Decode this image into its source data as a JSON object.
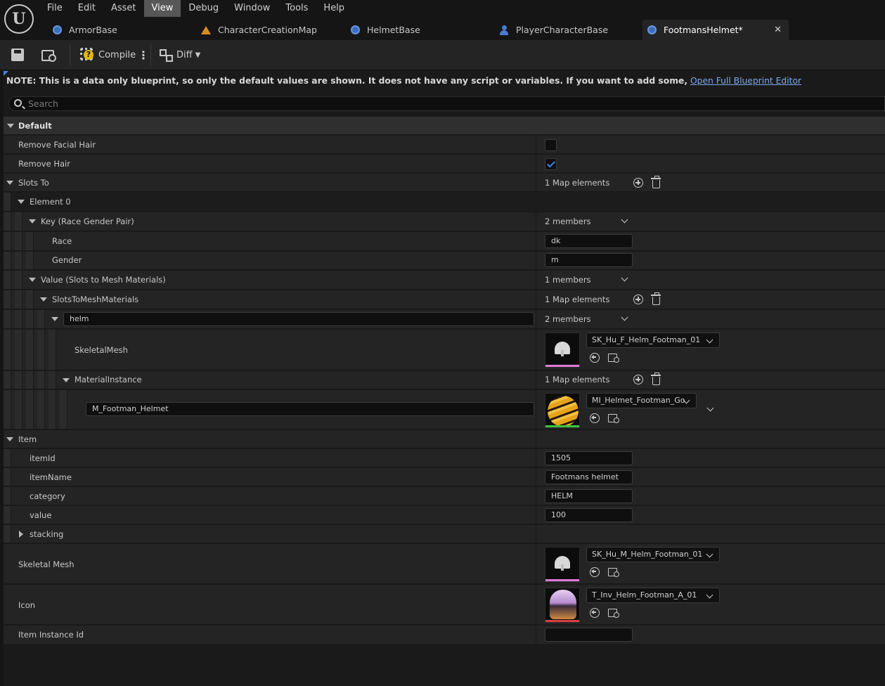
{
  "menu": [
    "File",
    "Edit",
    "Asset",
    "View",
    "Debug",
    "Window",
    "Tools",
    "Help"
  ],
  "menu_active": "View",
  "tabs": [
    {
      "label": "ArmorBase",
      "icon": "blueprint-icon"
    },
    {
      "label": "CharacterCreationMap",
      "icon": "level-map-icon"
    },
    {
      "label": "HelmetBase",
      "icon": "blueprint-icon"
    },
    {
      "label": "PlayerCharacterBase",
      "icon": "character-icon"
    },
    {
      "label": "FootmansHelmet*",
      "icon": "blueprint-icon",
      "active": true
    }
  ],
  "toolbar": {
    "compile_label": "Compile",
    "diff_label": "Diff"
  },
  "note": {
    "text": "NOTE: This is a data only blueprint, so only the default values are shown.  It does not have any script or variables.  If you want to add some,",
    "link": "Open Full Blueprint Editor"
  },
  "search": {
    "placeholder": "Search"
  },
  "details": {
    "default_category": "Default",
    "remove_facial_hair": {
      "label": "Remove Facial Hair",
      "checked": false
    },
    "remove_hair": {
      "label": "Remove Hair",
      "checked": true
    },
    "slots_to": {
      "label": "Slots To",
      "value": "1 Map elements"
    },
    "element0": {
      "label": "Element 0"
    },
    "key": {
      "label": "Key (Race Gender Pair)",
      "value": "2 members"
    },
    "race": {
      "label": "Race",
      "value": "dk"
    },
    "gender": {
      "label": "Gender",
      "value": "m"
    },
    "value_struct": {
      "label": "Value (Slots to Mesh Materials)",
      "value": "1 members"
    },
    "slots_to_mesh": {
      "label": "SlotsToMeshMaterials",
      "value": "1 Map elements"
    },
    "helm": {
      "key": "helm",
      "value": "2 members"
    },
    "skeletal_mesh_inner": {
      "label": "SkeletalMesh",
      "asset": "SK_Hu_F_Helm_Footman_01"
    },
    "material_instance": {
      "label": "MaterialInstance",
      "value": "1 Map elements"
    },
    "material_entry": {
      "key": "M_Footman_Helmet",
      "asset": "MI_Helmet_Footman_Go"
    },
    "item_category": "Item",
    "item_id": {
      "label": "itemId",
      "value": "1505"
    },
    "item_name": {
      "label": "itemName",
      "value": "Footmans helmet"
    },
    "category": {
      "label": "category",
      "value": "HELM"
    },
    "value": {
      "label": "value",
      "value": "100"
    },
    "stacking": {
      "label": "stacking"
    },
    "skeletal_mesh": {
      "label": "Skeletal Mesh",
      "asset": "SK_Hu_M_Helm_Footman_01"
    },
    "icon": {
      "label": "Icon",
      "asset": "T_Inv_Helm_Footman_A_01"
    },
    "item_instance_id": {
      "label": "Item Instance Id",
      "value": ""
    }
  },
  "colors": {
    "accent": "#3f8ae0",
    "link": "#7aaaf0",
    "mesh_bar": "#e07ad8",
    "material_bar": "#3cc43c",
    "texture_bar": "#d84040"
  }
}
